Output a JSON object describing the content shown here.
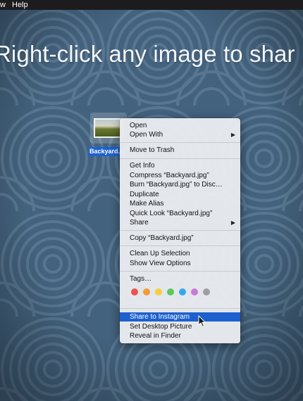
{
  "menubar": {
    "item_partial": "w",
    "help": "Help"
  },
  "headline": "Right-click any image to shar",
  "file": {
    "label": "Backyard.jpg"
  },
  "menu": {
    "open": "Open",
    "open_with": "Open With",
    "move_to_trash": "Move to Trash",
    "get_info": "Get Info",
    "compress": "Compress “Backyard.jpg”",
    "burn": "Burn “Backyard.jpg” to Disc…",
    "duplicate": "Duplicate",
    "make_alias": "Make Alias",
    "quick_look": "Quick Look “Backyard.jpg”",
    "share": "Share",
    "copy": "Copy “Backyard.jpg”",
    "clean_up": "Clean Up Selection",
    "view_options": "Show View Options",
    "tags": "Tags…",
    "share_instagram": "Share to Instagram",
    "set_desktop": "Set Desktop Picture",
    "reveal": "Reveal in Finder",
    "submenu_arrow": "▶"
  },
  "tag_colors": [
    "#f0524a",
    "#f59a36",
    "#f3cf3a",
    "#5cc75c",
    "#33a8ef",
    "#c979da",
    "#9e9ea3"
  ],
  "colors": {
    "highlight": "#1d60cf",
    "desktop": "#41607a",
    "selection_label": "#1e62d2"
  }
}
